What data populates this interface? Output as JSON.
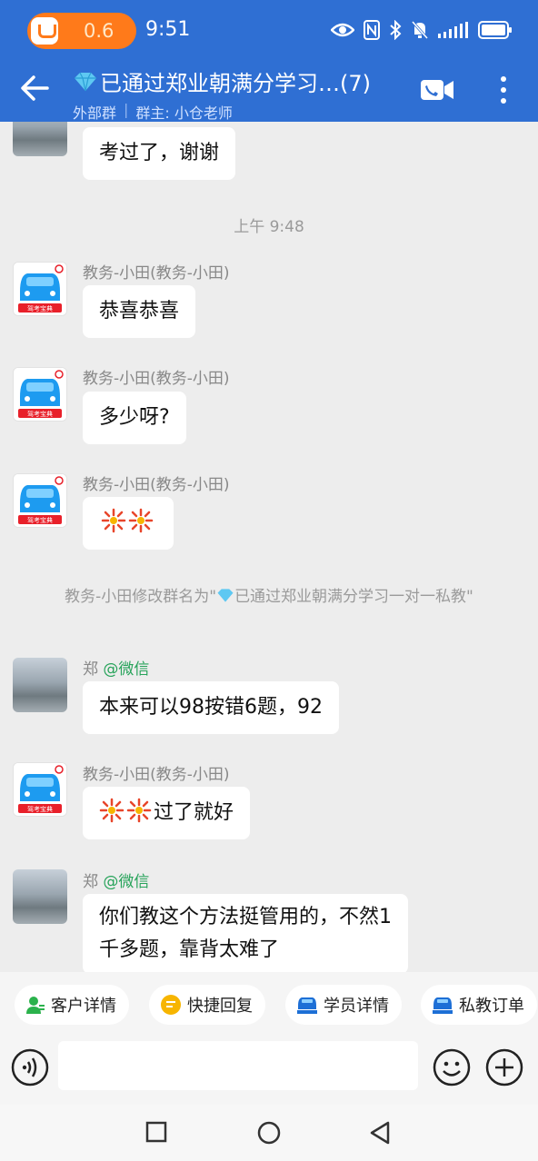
{
  "status_bar": {
    "speed": "0.6",
    "time": "9:51"
  },
  "header": {
    "title": "已通过郑业朝满分学习…(7)",
    "subtitle_tag": "外部群",
    "subtitle_owner": "群主: 小仓老师"
  },
  "avatar_badge": "驾考宝典",
  "messages": {
    "m1": {
      "text": "考过了，谢谢"
    },
    "t1": "上午 9:48",
    "m2": {
      "sender": "教务-小田(教务-小田)",
      "text": "恭喜恭喜"
    },
    "m3": {
      "sender": "教务-小田(教务-小田)",
      "text": "多少呀?"
    },
    "m4": {
      "sender": "教务-小田(教务-小田)"
    },
    "sys1": {
      "part1": "教务-小田修改群名为\"",
      "part2": "已通过郑业朝满分学习一对一私教\""
    },
    "m5": {
      "sender_name": "郑",
      "sender_source": "@微信",
      "text": "本来可以98按错6题，92"
    },
    "m6": {
      "sender": "教务-小田(教务-小田)",
      "text": "过了就好"
    },
    "m7": {
      "sender_name": "郑",
      "sender_source": "@微信",
      "text_line1": "你们教这个方法挺管用的，不然1",
      "text_line2": "千多题，靠背太难了"
    }
  },
  "quick_actions": [
    "客户详情",
    "快捷回复",
    "学员详情",
    "私教订单"
  ],
  "input": {
    "placeholder": ""
  },
  "colors": {
    "header_bg": "#2f6fd3",
    "wechat_green": "#27a35a",
    "chat_bg": "#ededed"
  }
}
